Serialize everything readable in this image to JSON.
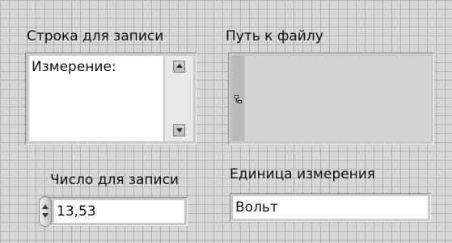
{
  "string_control": {
    "label": "Строка для записи",
    "value": "Измерение:"
  },
  "path_control": {
    "label": "Путь к файлу",
    "value": ""
  },
  "numeric_control": {
    "label": "Число для записи",
    "value": "13,53"
  },
  "unit_control": {
    "label": "Единица измерения",
    "value": "Вольт"
  },
  "icons": {
    "scroll_up": "scroll-up-arrow-icon",
    "scroll_down": "scroll-down-arrow-icon",
    "path_browse": "folder-tree-icon",
    "increment": "increment-arrow-icon",
    "decrement": "decrement-arrow-icon"
  },
  "colors": {
    "panel_background": "#d6d6d6",
    "grid_line": "#969696",
    "field_background": "#ffffff",
    "path_field_background": "#d3d3d3"
  }
}
